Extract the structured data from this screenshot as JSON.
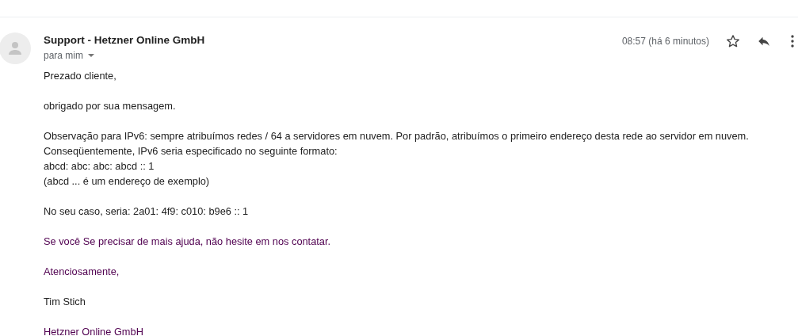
{
  "message": {
    "sender": "Support - Hetzner Online GmbH",
    "recipient": "para mim",
    "time": "08:57 (há 6 minutos)",
    "starred": false,
    "paragraphs": [
      {
        "kind": "plain",
        "lines": [
          "Prezado cliente,"
        ]
      },
      {
        "kind": "plain",
        "lines": [
          "obrigado por sua mensagem."
        ]
      },
      {
        "kind": "plain",
        "lines": [
          "Observação para IPv6: sempre atribuímos redes / 64 a servidores em nuvem. Por padrão, atribuímos o primeiro endereço desta rede ao servidor em nuvem.",
          "Conseqüentemente, IPv6 seria especificado no seguinte formato:",
          "abcd: abc: abc: abcd :: 1",
          "(abcd ... é um endereço de exemplo)"
        ]
      },
      {
        "kind": "plain",
        "lines": [
          "No seu caso, seria: 2a01: 4f9: c010: b9e6 :: 1"
        ]
      },
      {
        "kind": "trimmed",
        "lines": [
          "Se você Se precisar de mais ajuda, não hesite em nos contatar."
        ]
      },
      {
        "kind": "trimmed",
        "lines": [
          "Atenciosamente,"
        ]
      },
      {
        "kind": "plain",
        "lines": [
          "Tim Stich"
        ]
      },
      {
        "kind": "trimmed",
        "lines": [
          "Hetzner Online GmbH"
        ]
      }
    ]
  }
}
